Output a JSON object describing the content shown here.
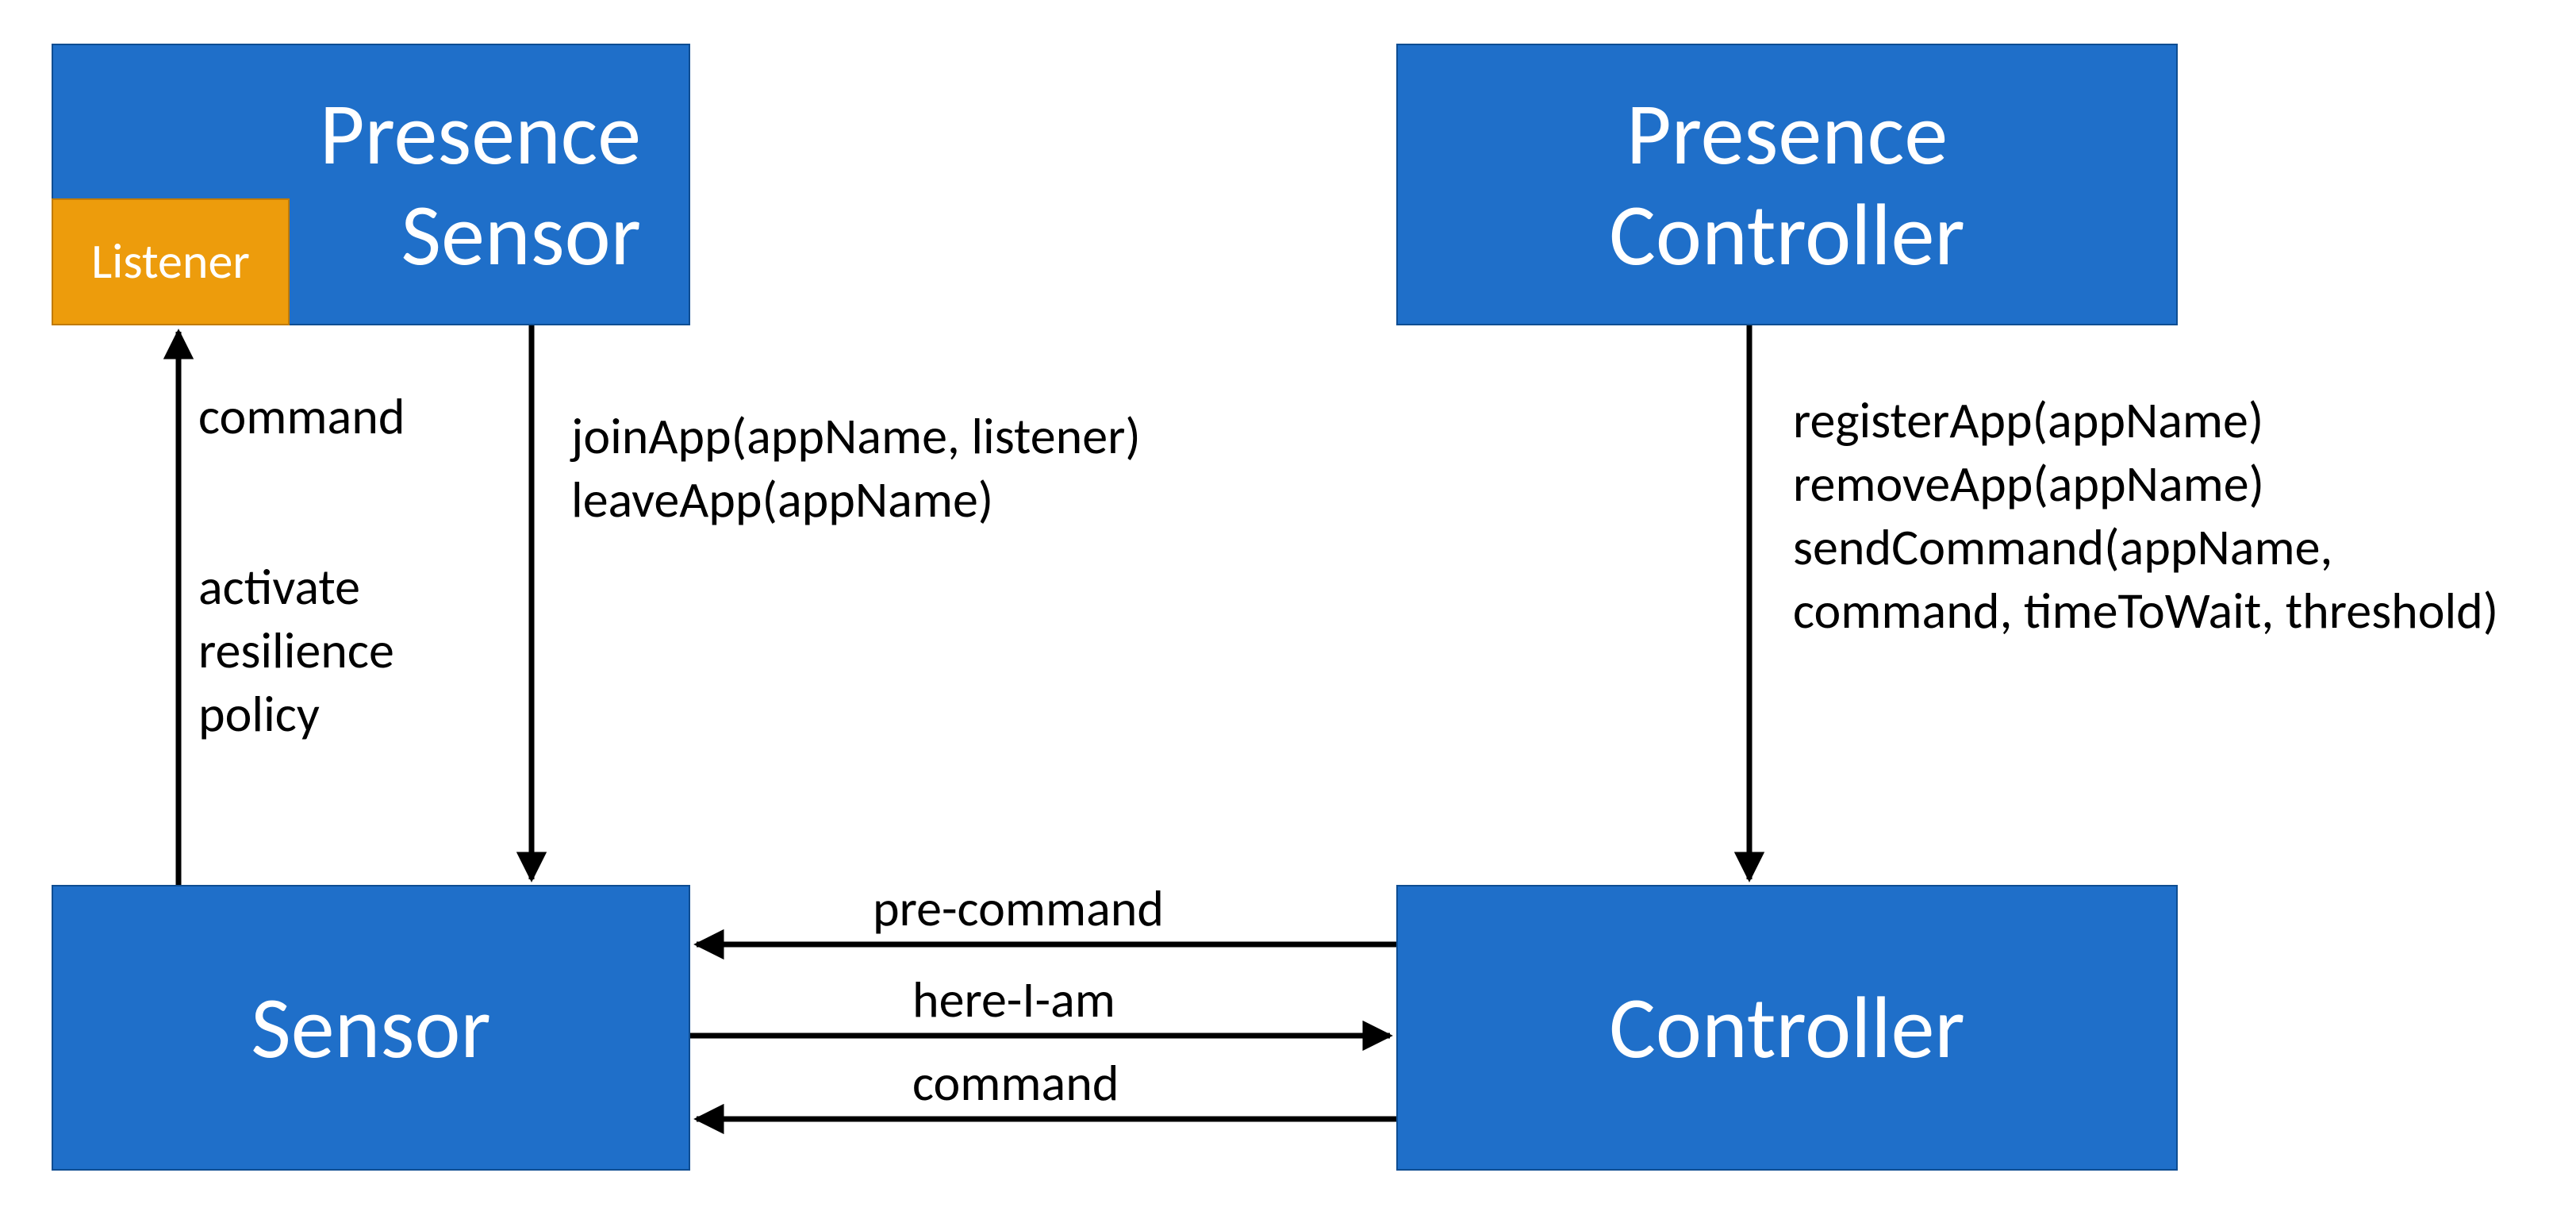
{
  "boxes": {
    "presence_sensor": "Presence\nSensor",
    "listener": "Listener",
    "presence_controller": "Presence\nController",
    "sensor": "Sensor",
    "controller": "Controller"
  },
  "labels": {
    "command_up": "command",
    "activate_resilience_policy": "activate\nresilience\npolicy",
    "join_leave": "joinApp(appName, listener)\nleaveApp(appName)",
    "controller_calls": "registerApp(appName)\nremoveApp(appName)\nsendCommand(appName,\ncommand, timeToWait, threshold)",
    "pre_command": "pre-command",
    "here_i_am": "here-I-am",
    "command_mid": "command"
  },
  "colors": {
    "blue": "#1F6FC9",
    "orange": "#ED9C0C"
  }
}
